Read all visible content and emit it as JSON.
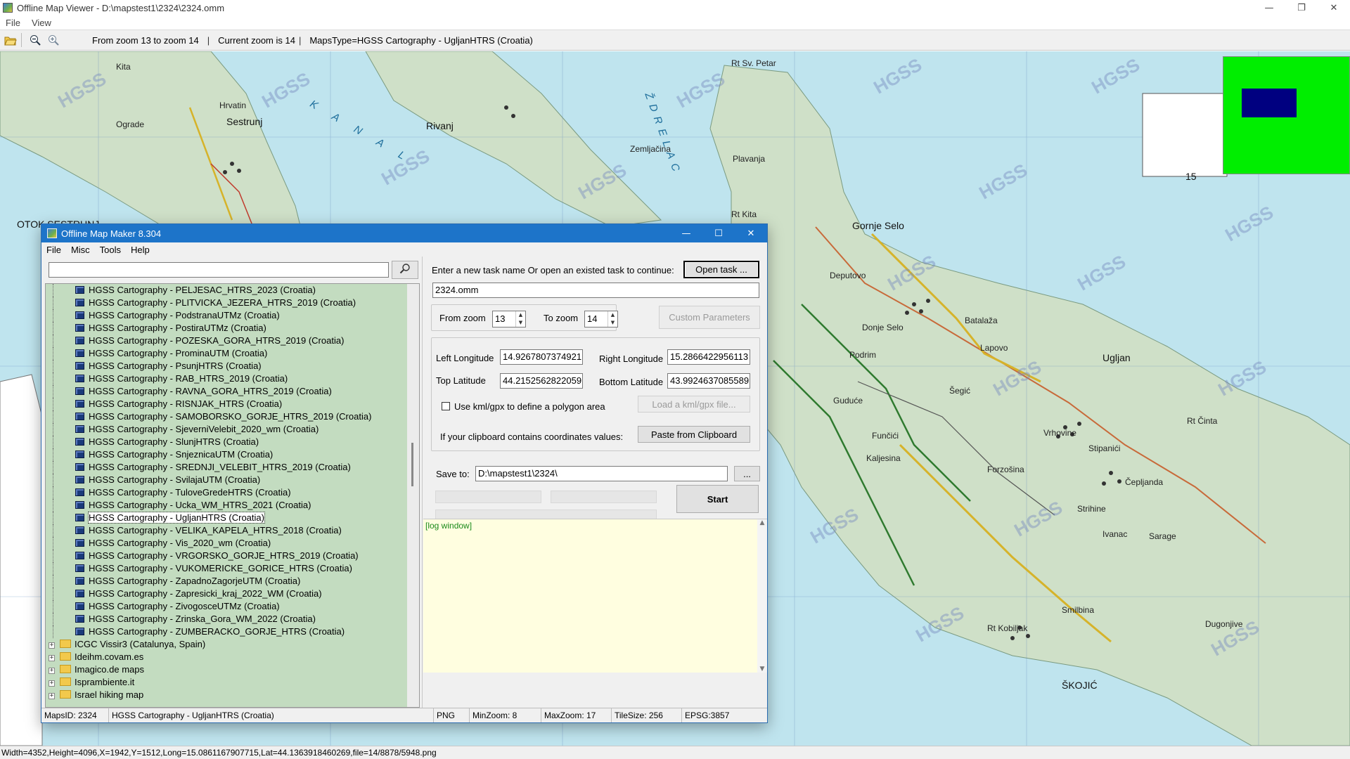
{
  "viewer": {
    "title": "Offline Map Viewer - D:\\mapstest1\\2324\\2324.omm",
    "menu": [
      "File",
      "View"
    ],
    "toolbar": {
      "zoom_range": "From zoom 13 to zoom 14",
      "sep1": "|",
      "current_zoom": "Current zoom is 14",
      "sep2": "|",
      "maps_type": "MapsType=HGSS Cartography - UgljanHTRS (Croatia)"
    },
    "status": "Width=4352,Height=4096,X=1942,Y=1512,Long=15.0861167907715,Lat=44.1363918460269,file=14/8878/5948.png"
  },
  "map": {
    "watermark": "HGSS",
    "labels": {
      "sestrunj": "Sestrunj",
      "rivanj": "Rivanj",
      "ugljan": "Ugljan",
      "gornje_selo": "Gornje Selo",
      "deputovo": "Deputovo",
      "lapovo": "Lapovo",
      "batalaza": "Batalaža",
      "funcici": "Funčići",
      "vrhovine": "Vrhovine",
      "stipanici": "Stipanići",
      "forzosina": "Forzošina",
      "strihine": "Strihine",
      "ivanac": "Ivanac",
      "sarage": "Sarage",
      "cepljanda": "Čepljanda",
      "dugonjive": "Dugonjive",
      "skojic": "ŠKOJIĆ",
      "otok_sestrunj": "OTOK SESTRUNJ",
      "ograde": "Ograde",
      "hrvatin": "Hrvatin",
      "kita": "Kita",
      "plavanja": "Plavanja",
      "pristaniste": "Zemljačina",
      "guduce": "Guduće",
      "kaljesina": "Kaljesina",
      "podrim": "Podrim",
      "donje_selo": "Donje Selo",
      "segic": "Šegić",
      "smilbina": "Smilbina",
      "rt_petar": "Rt Sv. Petar",
      "rt_kita": "Rt Kita",
      "rt_cinta": "Rt Činta",
      "rt_kobiljak": "Rt Kobiljak",
      "sea_kanal": "KANAL",
      "sea_zdrelac": "ŽDRELAC",
      "sheet_number": "15"
    }
  },
  "omm": {
    "title": "Offline Map Maker 8.304",
    "menu": [
      "File",
      "Misc",
      "Tools",
      "Help"
    ],
    "search_placeholder": "",
    "tree_leaves": [
      "HGSS Cartography - PELJESAC_HTRS_2023 (Croatia)",
      "HGSS Cartography - PLITVICKA_JEZERA_HTRS_2019 (Croatia)",
      "HGSS Cartography - PodstranaUTMz (Croatia)",
      "HGSS Cartography - PostiraUTMz (Croatia)",
      "HGSS Cartography - POZESKA_GORA_HTRS_2019 (Croatia)",
      "HGSS Cartography - ProminaUTM (Croatia)",
      "HGSS Cartography - PsunjHTRS (Croatia)",
      "HGSS Cartography - RAB_HTRS_2019 (Croatia)",
      "HGSS Cartography - RAVNA_GORA_HTRS_2019 (Croatia)",
      "HGSS Cartography - RISNJAK_HTRS (Croatia)",
      "HGSS Cartography - SAMOBORSKO_GORJE_HTRS_2019 (Croatia)",
      "HGSS Cartography - SjeverniVelebit_2020_wm (Croatia)",
      "HGSS Cartography - SlunjHTRS (Croatia)",
      "HGSS Cartography - SnjeznicaUTM (Croatia)",
      "HGSS Cartography - SREDNJI_VELEBIT_HTRS_2019 (Croatia)",
      "HGSS Cartography - SvilajaUTM (Croatia)",
      "HGSS Cartography - TuloveGredeHTRS (Croatia)",
      "HGSS Cartography - Ucka_WM_HTRS_2021 (Croatia)",
      "HGSS Cartography - UgljanHTRS (Croatia)",
      "HGSS Cartography - VELIKA_KAPELA_HTRS_2018 (Croatia)",
      "HGSS Cartography - Vis_2020_wm (Croatia)",
      "HGSS Cartography - VRGORSKO_GORJE_HTRS_2019 (Croatia)",
      "HGSS Cartography - VUKOMERICKE_GORICE_HTRS (Croatia)",
      "HGSS Cartography - ZapadnoZagorjeUTM (Croatia)",
      "HGSS Cartography - Zapresicki_kraj_2022_WM (Croatia)",
      "HGSS Cartography - ZivogosceUTMz (Croatia)",
      "HGSS Cartography - Zrinska_Gora_WM_2022 (Croatia)",
      "HGSS Cartography - ZUMBERACKO_GORJE_HTRS (Croatia)"
    ],
    "selected_leaf_index": 18,
    "tree_folders": [
      "ICGC Vissir3 (Catalunya, Spain)",
      "Ideihm.covam.es",
      "Imagico.de maps",
      "Isprambiente.it",
      "Israel hiking map"
    ],
    "task_prompt": "Enter a new task name Or open an existed task to continue:",
    "open_task": "Open task ...",
    "task_name": "2324.omm",
    "from_zoom_label": "From zoom",
    "from_zoom": "13",
    "to_zoom_label": "To zoom",
    "to_zoom": "14",
    "custom_params": "Custom Parameters",
    "left_lon_label": "Left Longitude",
    "left_lon": "14.9267807374921",
    "right_lon_label": "Right Longitude",
    "right_lon": "15.2866422956113",
    "top_lat_label": "Top Latitude",
    "top_lat": "44.2152562822059",
    "bottom_lat_label": "Bottom Latitude",
    "bottom_lat": "43.9924637085589",
    "kml_label": "Use kml/gpx to define a polygon area",
    "kml_checked": false,
    "load_kml": "Load a kml/gpx file...",
    "clipboard_label": "If your clipboard contains coordinates values:",
    "paste_clipboard": "Paste from Clipboard",
    "save_to_label": "Save to:",
    "save_to": "D:\\mapstest1\\2324\\",
    "browse": "...",
    "start": "Start",
    "log": "[log window]",
    "status": {
      "maps_id": "MapsID: 2324",
      "map_name": "HGSS Cartography - UgljanHTRS (Croatia)",
      "format": "PNG",
      "min_zoom": "MinZoom: 8",
      "max_zoom": "MaxZoom: 17",
      "tile_size": "TileSize: 256",
      "epsg": "EPSG:3857"
    }
  },
  "icons": {
    "open": "folder-open-icon",
    "zoom_out": "zoom-out-icon",
    "zoom_in": "zoom-in-icon",
    "search": "search-icon",
    "leaf": "map-node-icon",
    "folder": "folder-icon"
  },
  "colors": {
    "tree_bg": "#c3dcc0",
    "log_bg": "#fffee0",
    "log_text": "#1b8a1b",
    "minimap_bg": "#00ee00",
    "minimap_view": "#000080",
    "sea": "#bfe4ee",
    "land": "#cfe0c8",
    "titlebar": "#1d74c9"
  }
}
